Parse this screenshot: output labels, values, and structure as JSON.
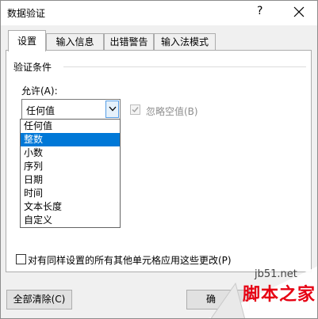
{
  "window": {
    "title": "数据验证",
    "help": "?"
  },
  "tabs": [
    {
      "label": "设置",
      "active": true
    },
    {
      "label": "输入信息",
      "active": false
    },
    {
      "label": "出错警告",
      "active": false
    },
    {
      "label": "输入法模式",
      "active": false
    }
  ],
  "criteria": {
    "group_label": "验证条件",
    "allow_label": "允许(A):",
    "allow_value": "任何值",
    "ignore_blank_label": "忽略空值(B)",
    "ignore_blank_checked": true,
    "ignore_blank_disabled": true
  },
  "dropdown": {
    "options": [
      "任何值",
      "整数",
      "小数",
      "序列",
      "日期",
      "时间",
      "文本长度",
      "自定义"
    ],
    "highlighted": "整数"
  },
  "apply_all": {
    "label": "对有同样设置的所有其他单元格应用这些更改(P)",
    "checked": false
  },
  "buttons": {
    "clear_all": "全部清除(C)",
    "ok_partial": "确"
  },
  "watermark": {
    "site": "jb51.net",
    "brand": "脚本之家"
  },
  "colors": {
    "selection": "#0078d7",
    "focus_border": "#569de5",
    "brand_red": "#e60012"
  }
}
